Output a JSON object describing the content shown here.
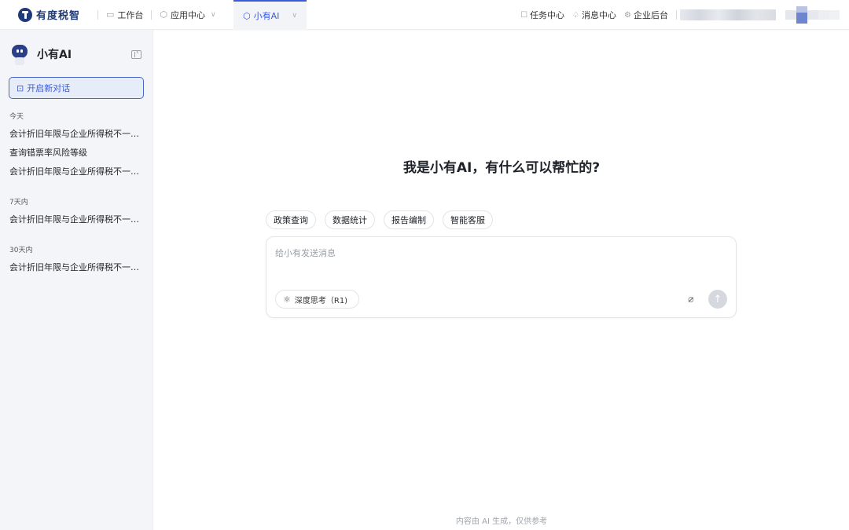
{
  "brand": {
    "name": "有度税智"
  },
  "nav": {
    "workbench": "工作台",
    "app_center": "应用中心",
    "active_tab": "小有AI"
  },
  "top_right": {
    "tasks": "任务中心",
    "messages": "消息中心",
    "admin": "企业后台"
  },
  "sidebar": {
    "title": "小有AI",
    "new_chat": "开启新对话",
    "groups": [
      {
        "label": "今天",
        "items": [
          "会计折旧年限与企业所得税不一致的处理",
          "查询错票率风险等级",
          "会计折旧年限与企业所得税不一致的处理"
        ]
      },
      {
        "label": "7天内",
        "items": [
          "会计折旧年限与企业所得税不一致的处理"
        ]
      },
      {
        "label": "30天内",
        "items": [
          "会计折旧年限与企业所得税不一致的处理"
        ]
      }
    ]
  },
  "main": {
    "headline": "我是小有AI，有什么可以帮忙的?",
    "chips": [
      "政策查询",
      "数据统计",
      "报告编制",
      "智能客服"
    ],
    "input_placeholder": "给小有发送消息",
    "deep_think": "深度思考（R1)",
    "footer": "内容由 AI 生成，仅供参考"
  },
  "colors": {
    "accent": "#3b5bdb",
    "brand": "#1f3a7a",
    "sidebar_bg": "#f3f5f8"
  },
  "icons": [
    "monitor-icon",
    "cube-icon",
    "cube-icon",
    "task-icon",
    "bell-icon",
    "gear-icon",
    "collapse-icon",
    "chat-plus-icon",
    "atom-icon",
    "paperclip-icon",
    "arrow-up-icon"
  ]
}
